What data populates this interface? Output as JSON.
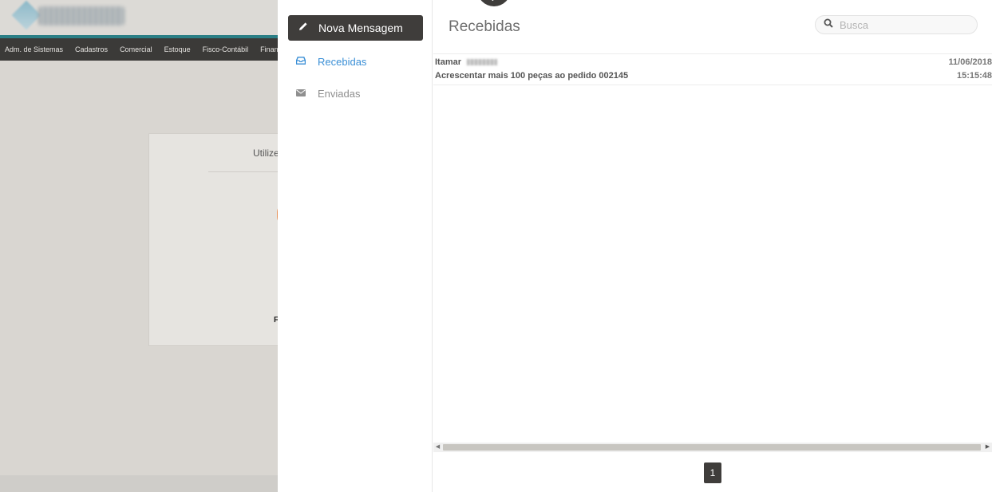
{
  "background": {
    "nav_items": [
      "Adm. de Sistemas",
      "Cadastros",
      "Comercial",
      "Estoque",
      "Fisco-Contábil",
      "Financ"
    ],
    "card_title": "Utilize",
    "card_letter": "F"
  },
  "sidebar": {
    "compose_label": "Nova Mensagem",
    "folders": [
      {
        "label": "Recebidas",
        "icon": "inbox-icon",
        "active": true
      },
      {
        "label": "Enviadas",
        "icon": "envelope-icon",
        "active": false
      }
    ]
  },
  "main": {
    "title": "Recebidas",
    "search_placeholder": "Busca",
    "messages": [
      {
        "from": "Itamar",
        "subject": "Acrescentar mais 100 peças ao pedido 002145",
        "date": "11/06/2018",
        "time": "15:15:48"
      }
    ],
    "pagination": {
      "current_page": "1"
    }
  },
  "colors": {
    "accent": "#3a8fd6",
    "dark_button": "#3f3d3b",
    "header_teal": "#2b7f86",
    "nav_bar": "#3b3a38",
    "background_gray": "#d9d6d1",
    "card_orange": "#e8823f"
  }
}
